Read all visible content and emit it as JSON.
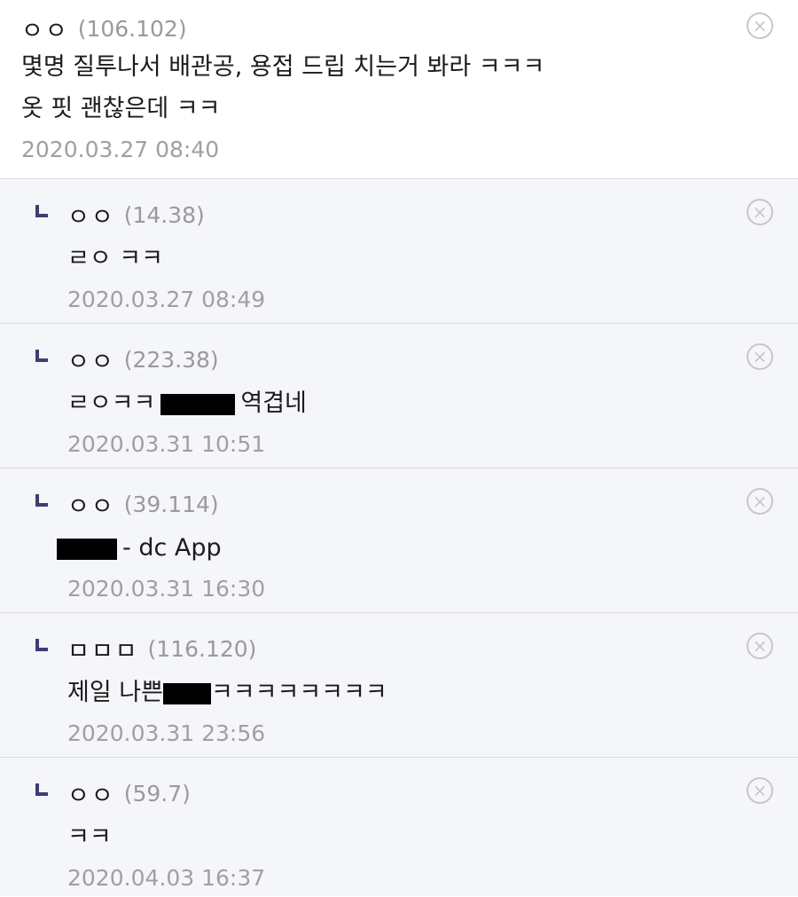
{
  "comments": [
    {
      "nick": "ㅇㅇ",
      "ip": "(106.102)",
      "text": "몇명 질투나서 배관공, 용접 드립 치는거 봐라 ㅋㅋㅋ",
      "text2": "옷 핏 괜찮은데 ㅋㅋ",
      "date": "2020.03.27 08:40"
    },
    {
      "nick": "ㅇㅇ",
      "ip": "(14.38)",
      "text": "ㄹㅇ ㅋㅋ",
      "date": "2020.03.27 08:49"
    },
    {
      "nick": "ㅇㅇ",
      "ip": "(223.38)",
      "text_before": "ㄹㅇㅋㅋ",
      "text_after": "역겹네",
      "date": "2020.03.31 10:51"
    },
    {
      "nick": "ㅇㅇ",
      "ip": "(39.114)",
      "text_after": "- dc App",
      "date": "2020.03.31 16:30"
    },
    {
      "nick": "ㅁㅁㅁ",
      "ip": "(116.120)",
      "text_before": "제일 나쁜",
      "text_after": "ㅋㅋㅋㅋㅋㅋㅋㅋ",
      "date": "2020.03.31 23:56"
    },
    {
      "nick": "ㅇㅇ",
      "ip": "(59.7)",
      "text": "ㅋㅋ",
      "date": "2020.04.03 16:37"
    }
  ],
  "delete_glyph": "×"
}
